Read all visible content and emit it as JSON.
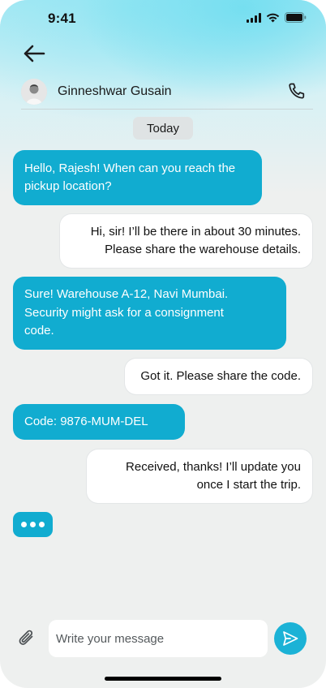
{
  "status_bar": {
    "time": "9:41"
  },
  "header": {
    "contact_name": "Ginneshwar Gusain",
    "icons": {
      "back": "arrow-left-icon",
      "call": "phone-icon"
    }
  },
  "date_separator": "Today",
  "messages": [
    {
      "direction": "incoming",
      "lines": [
        "Hello, Rajesh! When can you reach the",
        "pickup location?"
      ]
    },
    {
      "direction": "outgoing",
      "lines": [
        "Hi, sir! I’ll be there in about 30 minutes.",
        "Please share the warehouse details."
      ]
    },
    {
      "direction": "incoming",
      "lines": [
        "Sure! Warehouse A-12, Navi Mumbai.",
        "Security might ask for a consignment",
        "code."
      ]
    },
    {
      "direction": "outgoing",
      "lines": [
        "Got it. Please share the code."
      ]
    },
    {
      "direction": "incoming",
      "lines": [
        "Code: 9876-MUM-DEL"
      ]
    },
    {
      "direction": "outgoing",
      "lines": [
        "Received, thanks! I’ll update you",
        "once I start the trip."
      ]
    }
  ],
  "typing_indicator": true,
  "composer": {
    "placeholder": "Write your message",
    "icons": {
      "attach": "paperclip-icon",
      "send": "send-icon"
    }
  },
  "colors": {
    "accent": "#11acd0",
    "incoming_bubble": "#11acd0",
    "outgoing_bubble": "#ffffff",
    "background": "#eef0ef",
    "date_chip": "#dfe3e4"
  }
}
